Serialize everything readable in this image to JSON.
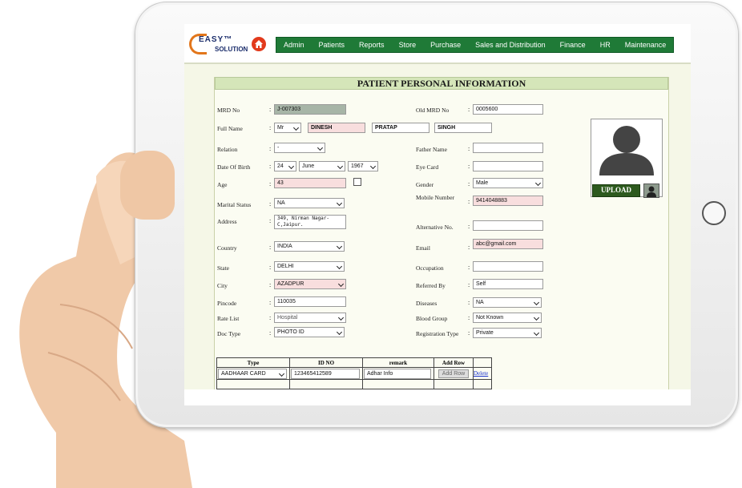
{
  "app": {
    "logo_top": "EASY™",
    "logo_bottom": "SOLUTION"
  },
  "nav": [
    "Admin",
    "Patients",
    "Reports",
    "Store",
    "Purchase",
    "Sales and Distribution",
    "Finance",
    "HR",
    "Maintenance"
  ],
  "form": {
    "title": "PATIENT PERSONAL INFORMATION",
    "labels": {
      "mrd": "MRD No",
      "old_mrd": "Old MRD No",
      "full_name": "Full Name",
      "relation": "Relation",
      "father": "Father Name",
      "dob": "Date Of Birth",
      "eye": "Eye Card",
      "age": "Age",
      "gender": "Gender",
      "mobile": "Mobile Number",
      "marital": "Marital Status",
      "address": "Address",
      "alt": "Alternative No.",
      "country": "Country",
      "email": "Email",
      "state": "State",
      "occupation": "Occupation",
      "city": "City",
      "referred": "Referred By",
      "pincode": "Pincode",
      "diseases": "Diseases",
      "rate": "Rate List",
      "blood": "Blood Group",
      "doc": "Doc Type",
      "reg": "Registration Type"
    },
    "values": {
      "mrd": "J-007303",
      "old_mrd": "0005600",
      "title": "Mr",
      "first": "DINESH",
      "middle": "PRATAP",
      "last": "SINGH",
      "relation": "-",
      "father": "",
      "dob_day": "24",
      "dob_month": "June",
      "dob_year": "1967",
      "eye": "",
      "age": "43",
      "gender": "Male",
      "mobile": "9414048883",
      "marital": "NA",
      "address": "349, Nirman Nagar-C,Jaipur.",
      "alt": "",
      "country": "INDIA",
      "email": "abc@gmail.com",
      "state": "DELHI",
      "occupation": "",
      "city": "AZADPUR",
      "referred": "Self",
      "pincode": "110035",
      "diseases": "NA",
      "rate": "Hospital",
      "blood": "Not Known",
      "doc": "PHOTO ID",
      "reg": "Private"
    },
    "upload_label": "UPLOAD"
  },
  "table": {
    "headers": [
      "Type",
      "ID NO",
      "remark",
      "Add Row"
    ],
    "row": {
      "type": "AADHAAR CARD",
      "id": "123465412589",
      "remark": "Adhar Info",
      "add": "Add Row",
      "delete": "Delete"
    }
  },
  "colors": {
    "nav_green": "#1f7a37",
    "title_bar": "#d5e6b9",
    "pink_field": "#f8dede",
    "home_red": "#e23a1c"
  }
}
